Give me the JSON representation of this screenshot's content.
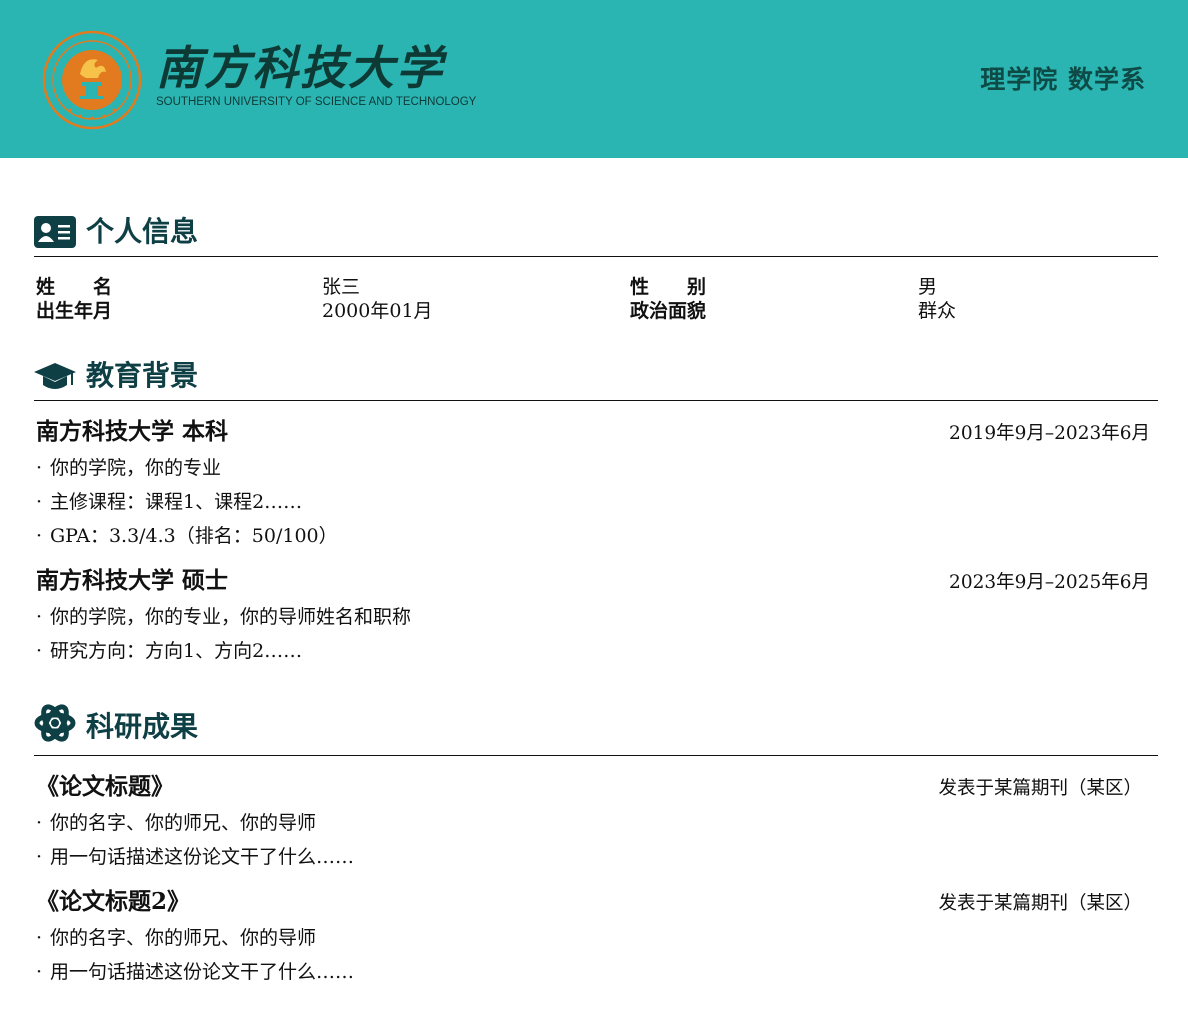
{
  "header": {
    "logo_cn": "南方科技大学",
    "logo_en": "SOUTHERN UNIVERSITY OF SCIENCE AND TECHNOLOGY",
    "department": "理学院 数学系",
    "colors": {
      "banner": "#2bb5b2",
      "dark_teal": "#0e3f44",
      "seal_orange": "#e27a1f"
    }
  },
  "sections": {
    "personal": {
      "title": "个人信息",
      "icon": "id-card-icon"
    },
    "education": {
      "title": "教育背景",
      "icon": "graduation-cap-icon"
    },
    "research": {
      "title": "科研成果",
      "icon": "atom-icon"
    }
  },
  "personal_info": {
    "name_label": "姓　　名",
    "name_value": "张三",
    "gender_label": "性　　别",
    "gender_value": "男",
    "birth_label": "出生年月",
    "birth_value": "2000年01月",
    "politics_label": "政治面貌",
    "politics_value": "群众"
  },
  "education": [
    {
      "title": "南方科技大学 本科",
      "period": "2019年9月–2023年6月",
      "bullets": [
        "你的学院，你的专业",
        "主修课程：课程1、课程2……",
        "GPA：3.3/4.3（排名：50/100）"
      ]
    },
    {
      "title": "南方科技大学 硕士",
      "period": "2023年9月–2025年6月",
      "bullets": [
        "你的学院，你的专业，你的导师姓名和职称",
        "研究方向：方向1、方向2……"
      ]
    }
  ],
  "research": [
    {
      "title": "《论文标题》",
      "venue": "发表于某篇期刊（某区）",
      "bullets": [
        "你的名字、你的师兄、你的导师",
        "用一句话描述这份论文干了什么……"
      ]
    },
    {
      "title": "《论文标题2》",
      "venue": "发表于某篇期刊（某区）",
      "bullets": [
        "你的名字、你的师兄、你的导师",
        "用一句话描述这份论文干了什么……"
      ]
    }
  ],
  "bullet_char": "·"
}
